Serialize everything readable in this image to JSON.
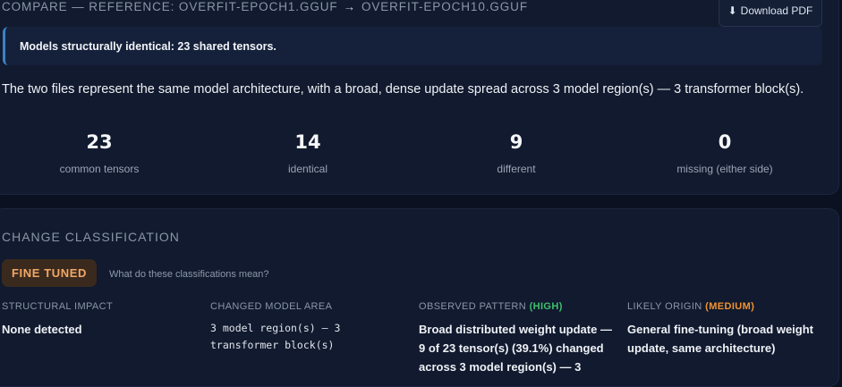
{
  "header": {
    "compare_prefix": "COMPARE — REFERENCE: OVERFIT-EPOCH1.GGUF",
    "arrow": "→",
    "target": "OVERFIT-EPOCH10.GGUF",
    "download_label": "Download PDF",
    "download_icon": "download-icon"
  },
  "alert": {
    "text": "Models structurally identical: 23 shared tensors."
  },
  "summary": "The two files represent the same model architecture, with a broad, dense update spread across 3 model region(s) — 3 transformer block(s).",
  "stats": [
    {
      "value": "23",
      "label": "common tensors"
    },
    {
      "value": "14",
      "label": "identical"
    },
    {
      "value": "9",
      "label": "different"
    },
    {
      "value": "0",
      "label": "missing (either side)"
    }
  ],
  "classification": {
    "title": "CHANGE CLASSIFICATION",
    "badge": "FINE TUNED",
    "badge_color": "#f2a865",
    "help_link": "What do these classifications mean?",
    "columns": [
      {
        "heading": "STRUCTURAL IMPACT",
        "confidence": "",
        "value": "None detected"
      },
      {
        "heading": "CHANGED MODEL AREA",
        "confidence": "",
        "value": "3 model region(s) — 3 transformer block(s)"
      },
      {
        "heading": "OBSERVED PATTERN",
        "confidence": "(HIGH)",
        "value": "Broad distributed weight update — 9 of 23 tensor(s) (39.1%) changed across 3 model region(s) — 3"
      },
      {
        "heading": "LIKELY ORIGIN",
        "confidence": "(MEDIUM)",
        "value": "General fine-tuning (broad weight update, same architecture)"
      }
    ]
  }
}
